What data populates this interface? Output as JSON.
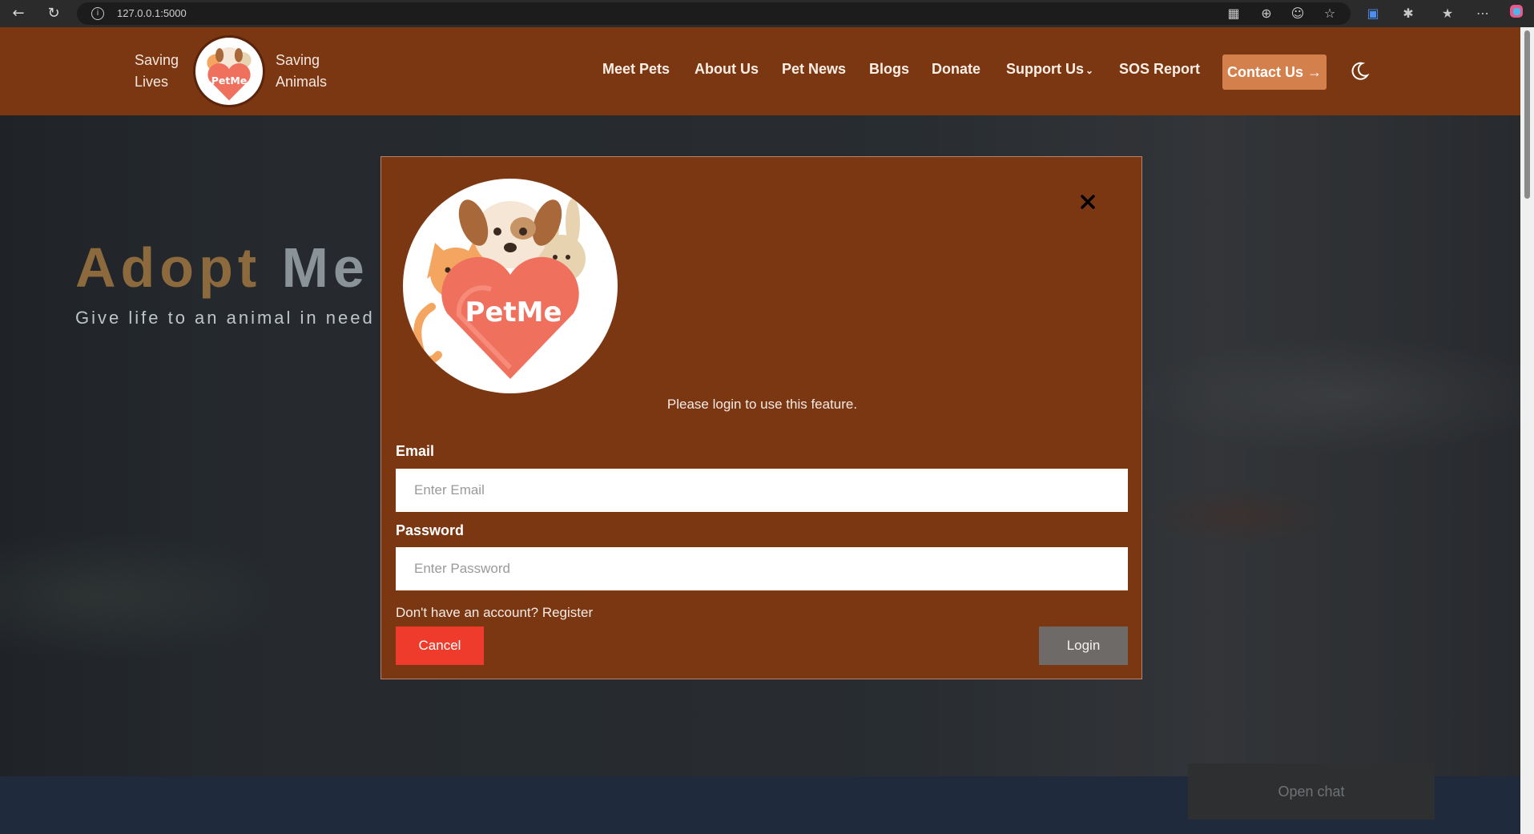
{
  "browser": {
    "url": "127.0.0.1:5000",
    "icons": [
      "back-icon",
      "reload-icon",
      "site-info-icon",
      "apps-icon",
      "zoom-icon",
      "emoji-icon",
      "favorite-star-icon",
      "screenshot-icon",
      "extensions-icon",
      "favorites-icon",
      "more-icon",
      "copilot-icon"
    ]
  },
  "header": {
    "brand_left_line1": "Saving",
    "brand_left_line2": "Lives",
    "brand_right_line1": "Saving",
    "brand_right_line2": "Animals",
    "logo_text": "PetMe",
    "nav": [
      "Meet Pets",
      "About Us",
      "Pet News",
      "Blogs",
      "Donate",
      "Support Us",
      "SOS Report"
    ],
    "contact_label": "Contact Us"
  },
  "hero": {
    "title_part1": "Adopt",
    "title_part2": "Me",
    "subtitle": "Give life to an animal in need"
  },
  "modal": {
    "logo_text": "PetMe",
    "message": "Please login to use this feature.",
    "email_label": "Email",
    "email_placeholder": "Enter Email",
    "password_label": "Password",
    "password_placeholder": "Enter Password",
    "register_text": "Don't have an account? Register",
    "cancel_label": "Cancel",
    "login_label": "Login"
  },
  "chat": {
    "open_label": "Open chat"
  },
  "colors": {
    "header_bg": "#7b3612",
    "contact_bg": "#d4804d",
    "cancel_bg": "#ee3b2b",
    "login_bg": "#6d6a68",
    "heart": "#f0705e"
  }
}
